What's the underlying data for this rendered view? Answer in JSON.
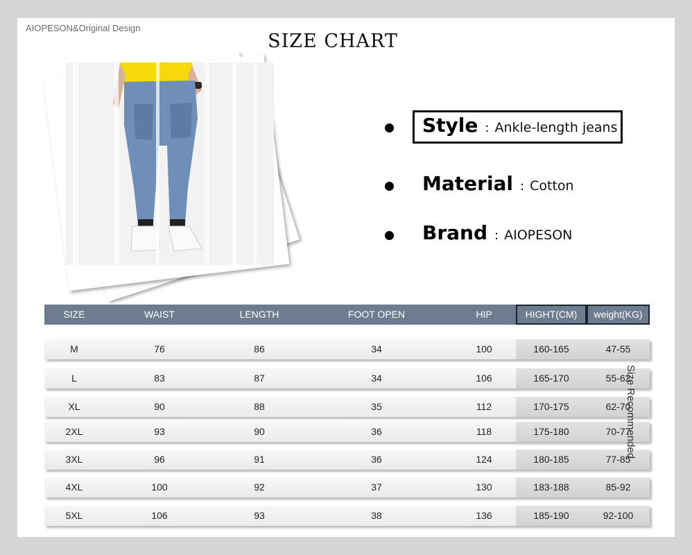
{
  "brand_line": "AIOPESON&Original Design",
  "title": "SIZE CHART",
  "info": [
    {
      "key": "Style",
      "sep": ":",
      "value": "Ankle-length jeans"
    },
    {
      "key": "Material",
      "sep": ":",
      "value": "Cotton"
    },
    {
      "key": "Brand",
      "sep": ":",
      "value": "AIOPESON"
    }
  ],
  "table": {
    "headers": [
      "SIZE",
      "WAIST",
      "LENGTH",
      "FOOT OPEN",
      "HIP",
      "HIGHT(CM)",
      "weight(KG)"
    ],
    "rows": [
      [
        "M",
        "76",
        "86",
        "34",
        "100",
        "160-165",
        "47-55"
      ],
      [
        "L",
        "83",
        "87",
        "34",
        "106",
        "165-170",
        "55-62"
      ],
      [
        "XL",
        "90",
        "88",
        "35",
        "112",
        "170-175",
        "62-70"
      ],
      [
        "2XL",
        "93",
        "90",
        "36",
        "118",
        "175-180",
        "70-77"
      ],
      [
        "3XL",
        "96",
        "91",
        "36",
        "124",
        "180-185",
        "77-85"
      ],
      [
        "4XL",
        "100",
        "92",
        "37",
        "130",
        "183-188",
        "85-92"
      ],
      [
        "5XL",
        "106",
        "93",
        "38",
        "136",
        "185-190",
        "92-100"
      ]
    ]
  },
  "side_label": "Size Recommended",
  "colors": {
    "header_bg": "#6d7c8f",
    "page_bg": "#d6d6d6",
    "shirt": "#f5d90a",
    "denim": "#6f8fb8"
  }
}
